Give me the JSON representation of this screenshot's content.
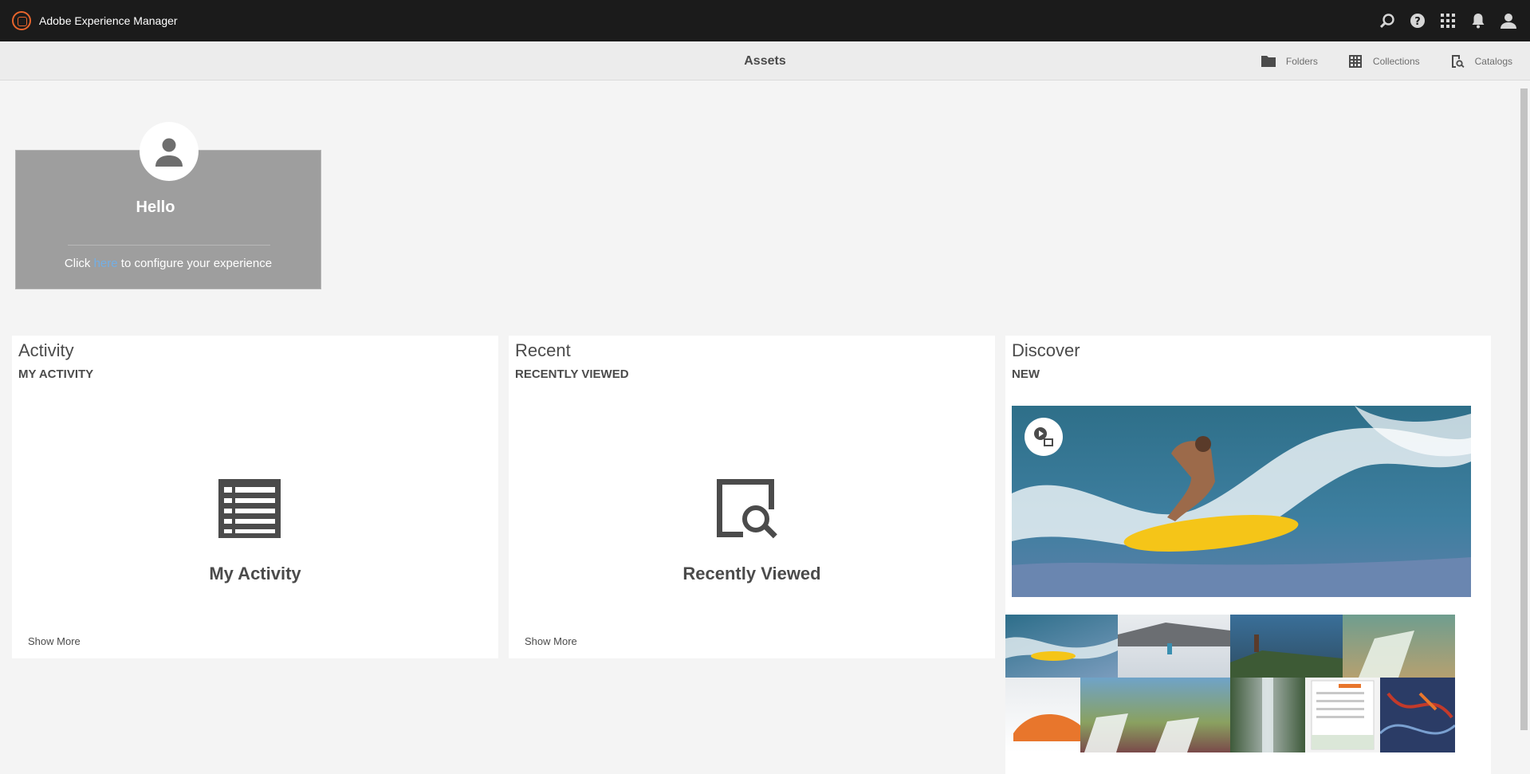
{
  "header": {
    "app_name": "Adobe Experience Manager",
    "icons": [
      "search-icon",
      "help-icon",
      "solutions-grid-icon",
      "notifications-bell-icon",
      "user-icon"
    ]
  },
  "subheader": {
    "title": "Assets",
    "actions": [
      {
        "label": "Folders",
        "icon": "folder-icon"
      },
      {
        "label": "Collections",
        "icon": "collections-grid-icon"
      },
      {
        "label": "Catalogs",
        "icon": "catalog-search-icon"
      }
    ]
  },
  "hello_card": {
    "title": "Hello",
    "text_before": "Click ",
    "link_text": "here",
    "text_after": " to configure your experience"
  },
  "cards": {
    "activity": {
      "title": "Activity",
      "subtitle": "MY ACTIVITY",
      "label": "My Activity",
      "show_more": "Show More"
    },
    "recent": {
      "title": "Recent",
      "subtitle": "RECENTLY VIEWED",
      "label": "Recently Viewed",
      "show_more": "Show More"
    },
    "discover": {
      "title": "Discover",
      "subtitle": "NEW"
    }
  },
  "colors": {
    "topbar": "#1b1b1b",
    "accent_logo": "#e8652c",
    "link": "#73aee4",
    "hello_card": "#9e9e9e"
  }
}
